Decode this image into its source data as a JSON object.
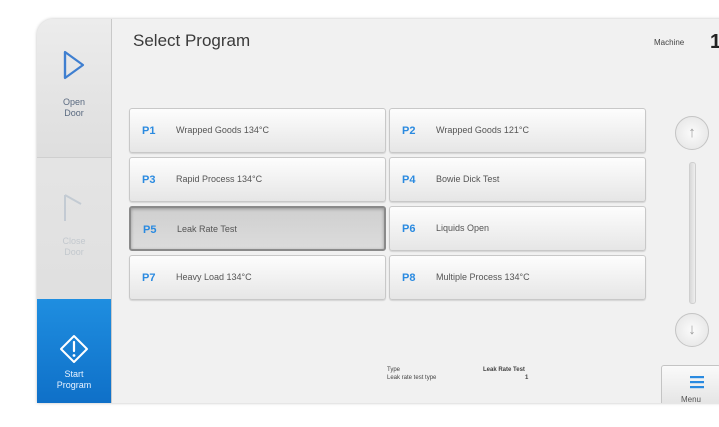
{
  "sidebar": {
    "open_door_label_1": "Open",
    "open_door_label_2": "Door",
    "close_door_label_1": "Close",
    "close_door_label_2": "Door",
    "start_label_1": "Start",
    "start_label_2": "Program",
    "icons": [
      "open-door-icon",
      "close-door-icon",
      "start-program-icon"
    ]
  },
  "header": {
    "title": "Select Program",
    "machine_label": "Machine",
    "machine_number": "1"
  },
  "programs": [
    {
      "id": "P1",
      "name": "Wrapped Goods 134°C",
      "selected": false
    },
    {
      "id": "P2",
      "name": "Wrapped Goods 121°C",
      "selected": false
    },
    {
      "id": "P3",
      "name": "Rapid Process 134°C",
      "selected": false
    },
    {
      "id": "P4",
      "name": "Bowie Dick Test",
      "selected": false
    },
    {
      "id": "P5",
      "name": "Leak Rate Test",
      "selected": true
    },
    {
      "id": "P6",
      "name": "Liquids Open",
      "selected": false
    },
    {
      "id": "P7",
      "name": "Heavy Load 134°C",
      "selected": false
    },
    {
      "id": "P8",
      "name": "Multiple Process 134°C",
      "selected": false
    }
  ],
  "scroll": {
    "up_icon": "↑",
    "down_icon": "↓"
  },
  "info": {
    "type_key": "Type",
    "type_value": "Leak Rate Test",
    "leak_key": "Leak rate test type",
    "leak_value": "1"
  },
  "menu": {
    "label": "Menu",
    "icon": "menu-icon"
  },
  "colors": {
    "accent": "#1a86dc",
    "program_id": "#2a8ae0"
  }
}
